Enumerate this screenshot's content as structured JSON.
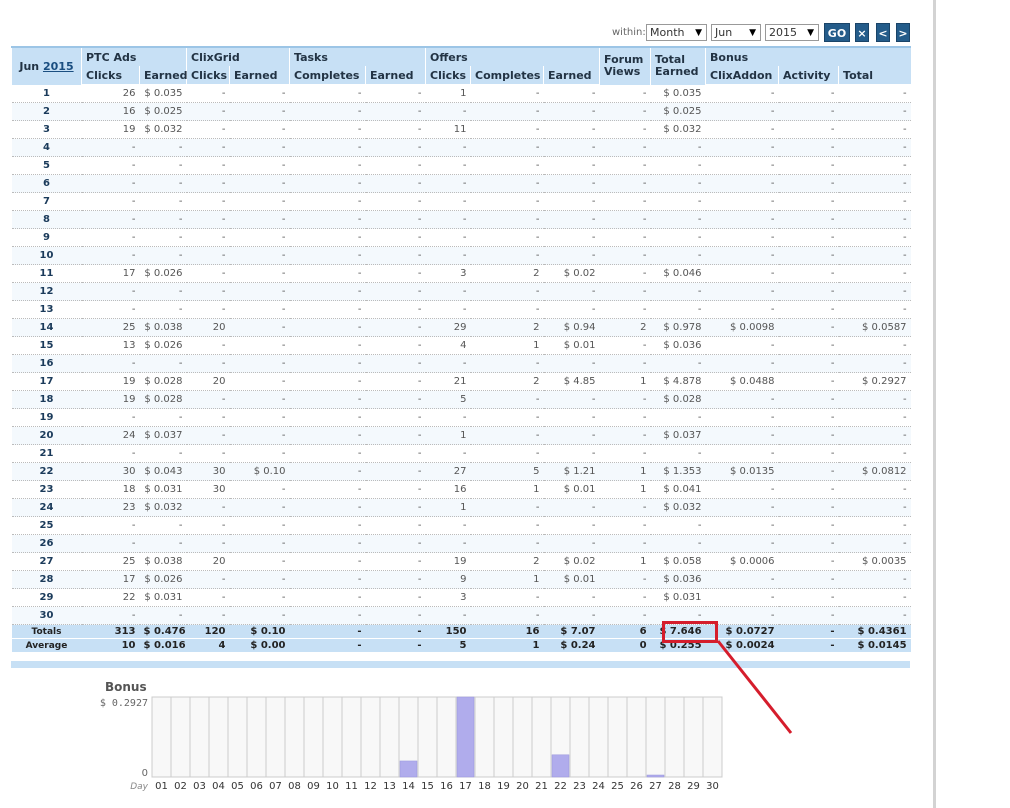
{
  "filters": {
    "within_label": "within:",
    "period": "Month",
    "month": "Jun",
    "year": "2015",
    "go_label": "GO",
    "close_label": "×",
    "prev_label": "<",
    "next_label": ">"
  },
  "table": {
    "month": "Jun",
    "year": "2015",
    "groups": {
      "ptc": "PTC Ads",
      "clixgrid": "ClixGrid",
      "tasks": "Tasks",
      "offers": "Offers",
      "forum_views": "Forum Views",
      "total_earned": "Total Earned",
      "bonus": "Bonus"
    },
    "subheaders": {
      "clicks": "Clicks",
      "earned": "Earned",
      "completes": "Completes",
      "clixaddon": "ClixAddon",
      "activity": "Activity",
      "total": "Total"
    },
    "rows": [
      [
        "1",
        "26",
        "$ 0.035",
        "-",
        "-",
        "-",
        "-",
        "1",
        "-",
        "-",
        "-",
        "$ 0.035",
        "-",
        "-",
        "-"
      ],
      [
        "2",
        "16",
        "$ 0.025",
        "-",
        "-",
        "-",
        "-",
        "-",
        "-",
        "-",
        "-",
        "$ 0.025",
        "-",
        "-",
        "-"
      ],
      [
        "3",
        "19",
        "$ 0.032",
        "-",
        "-",
        "-",
        "-",
        "11",
        "-",
        "-",
        "-",
        "$ 0.032",
        "-",
        "-",
        "-"
      ],
      [
        "4",
        "-",
        "-",
        "-",
        "-",
        "-",
        "-",
        "-",
        "-",
        "-",
        "-",
        "-",
        "-",
        "-",
        "-"
      ],
      [
        "5",
        "-",
        "-",
        "-",
        "-",
        "-",
        "-",
        "-",
        "-",
        "-",
        "-",
        "-",
        "-",
        "-",
        "-"
      ],
      [
        "6",
        "-",
        "-",
        "-",
        "-",
        "-",
        "-",
        "-",
        "-",
        "-",
        "-",
        "-",
        "-",
        "-",
        "-"
      ],
      [
        "7",
        "-",
        "-",
        "-",
        "-",
        "-",
        "-",
        "-",
        "-",
        "-",
        "-",
        "-",
        "-",
        "-",
        "-"
      ],
      [
        "8",
        "-",
        "-",
        "-",
        "-",
        "-",
        "-",
        "-",
        "-",
        "-",
        "-",
        "-",
        "-",
        "-",
        "-"
      ],
      [
        "9",
        "-",
        "-",
        "-",
        "-",
        "-",
        "-",
        "-",
        "-",
        "-",
        "-",
        "-",
        "-",
        "-",
        "-"
      ],
      [
        "10",
        "-",
        "-",
        "-",
        "-",
        "-",
        "-",
        "-",
        "-",
        "-",
        "-",
        "-",
        "-",
        "-",
        "-"
      ],
      [
        "11",
        "17",
        "$ 0.026",
        "-",
        "-",
        "-",
        "-",
        "3",
        "2",
        "$ 0.02",
        "-",
        "$ 0.046",
        "-",
        "-",
        "-"
      ],
      [
        "12",
        "-",
        "-",
        "-",
        "-",
        "-",
        "-",
        "-",
        "-",
        "-",
        "-",
        "-",
        "-",
        "-",
        "-"
      ],
      [
        "13",
        "-",
        "-",
        "-",
        "-",
        "-",
        "-",
        "-",
        "-",
        "-",
        "-",
        "-",
        "-",
        "-",
        "-"
      ],
      [
        "14",
        "25",
        "$ 0.038",
        "20",
        "-",
        "-",
        "-",
        "29",
        "2",
        "$ 0.94",
        "2",
        "$ 0.978",
        "$ 0.0098",
        "-",
        "$ 0.0587"
      ],
      [
        "15",
        "13",
        "$ 0.026",
        "-",
        "-",
        "-",
        "-",
        "4",
        "1",
        "$ 0.01",
        "-",
        "$ 0.036",
        "-",
        "-",
        "-"
      ],
      [
        "16",
        "-",
        "-",
        "-",
        "-",
        "-",
        "-",
        "-",
        "-",
        "-",
        "-",
        "-",
        "-",
        "-",
        "-"
      ],
      [
        "17",
        "19",
        "$ 0.028",
        "20",
        "-",
        "-",
        "-",
        "21",
        "2",
        "$ 4.85",
        "1",
        "$ 4.878",
        "$ 0.0488",
        "-",
        "$ 0.2927"
      ],
      [
        "18",
        "19",
        "$ 0.028",
        "-",
        "-",
        "-",
        "-",
        "5",
        "-",
        "-",
        "-",
        "$ 0.028",
        "-",
        "-",
        "-"
      ],
      [
        "19",
        "-",
        "-",
        "-",
        "-",
        "-",
        "-",
        "-",
        "-",
        "-",
        "-",
        "-",
        "-",
        "-",
        "-"
      ],
      [
        "20",
        "24",
        "$ 0.037",
        "-",
        "-",
        "-",
        "-",
        "1",
        "-",
        "-",
        "-",
        "$ 0.037",
        "-",
        "-",
        "-"
      ],
      [
        "21",
        "-",
        "-",
        "-",
        "-",
        "-",
        "-",
        "-",
        "-",
        "-",
        "-",
        "-",
        "-",
        "-",
        "-"
      ],
      [
        "22",
        "30",
        "$ 0.043",
        "30",
        "$ 0.10",
        "-",
        "-",
        "27",
        "5",
        "$ 1.21",
        "1",
        "$ 1.353",
        "$ 0.0135",
        "-",
        "$ 0.0812"
      ],
      [
        "23",
        "18",
        "$ 0.031",
        "30",
        "-",
        "-",
        "-",
        "16",
        "1",
        "$ 0.01",
        "1",
        "$ 0.041",
        "-",
        "-",
        "-"
      ],
      [
        "24",
        "23",
        "$ 0.032",
        "-",
        "-",
        "-",
        "-",
        "1",
        "-",
        "-",
        "-",
        "$ 0.032",
        "-",
        "-",
        "-"
      ],
      [
        "25",
        "-",
        "-",
        "-",
        "-",
        "-",
        "-",
        "-",
        "-",
        "-",
        "-",
        "-",
        "-",
        "-",
        "-"
      ],
      [
        "26",
        "-",
        "-",
        "-",
        "-",
        "-",
        "-",
        "-",
        "-",
        "-",
        "-",
        "-",
        "-",
        "-",
        "-"
      ],
      [
        "27",
        "25",
        "$ 0.038",
        "20",
        "-",
        "-",
        "-",
        "19",
        "2",
        "$ 0.02",
        "1",
        "$ 0.058",
        "$ 0.0006",
        "-",
        "$ 0.0035"
      ],
      [
        "28",
        "17",
        "$ 0.026",
        "-",
        "-",
        "-",
        "-",
        "9",
        "1",
        "$ 0.01",
        "-",
        "$ 0.036",
        "-",
        "-",
        "-"
      ],
      [
        "29",
        "22",
        "$ 0.031",
        "-",
        "-",
        "-",
        "-",
        "3",
        "-",
        "-",
        "-",
        "$ 0.031",
        "-",
        "-",
        "-"
      ],
      [
        "30",
        "-",
        "-",
        "-",
        "-",
        "-",
        "-",
        "-",
        "-",
        "-",
        "-",
        "-",
        "-",
        "-",
        "-"
      ]
    ],
    "totals": [
      "Totals",
      "313",
      "$ 0.476",
      "120",
      "$ 0.10",
      "-",
      "-",
      "150",
      "16",
      "$ 7.07",
      "6",
      "$ 7.646",
      "$ 0.0727",
      "-",
      "$ 0.4361"
    ],
    "average": [
      "Average",
      "10",
      "$ 0.016",
      "4",
      "$ 0.00",
      "-",
      "-",
      "5",
      "1",
      "$ 0.24",
      "0",
      "$ 0.255",
      "$ 0.0024",
      "-",
      "$ 0.0145"
    ]
  },
  "annotation": {
    "color": "#d51d2c"
  },
  "chart_data": {
    "type": "bar",
    "title": "Bonus",
    "xlabel": "Day",
    "ymax_label": "$ 0.2927",
    "ymin_label": "0",
    "ylim": [
      0,
      0.2927
    ],
    "categories": [
      "01",
      "02",
      "03",
      "04",
      "05",
      "06",
      "07",
      "08",
      "09",
      "10",
      "11",
      "12",
      "13",
      "14",
      "15",
      "16",
      "17",
      "18",
      "19",
      "20",
      "21",
      "22",
      "23",
      "24",
      "25",
      "26",
      "27",
      "28",
      "29",
      "30"
    ],
    "values": [
      0,
      0,
      0,
      0,
      0,
      0,
      0,
      0,
      0,
      0,
      0,
      0,
      0,
      0.0587,
      0,
      0,
      0.2927,
      0,
      0,
      0,
      0,
      0.0812,
      0,
      0,
      0,
      0,
      0.0035,
      0,
      0,
      0
    ],
    "bar_color": "#b0acec"
  }
}
